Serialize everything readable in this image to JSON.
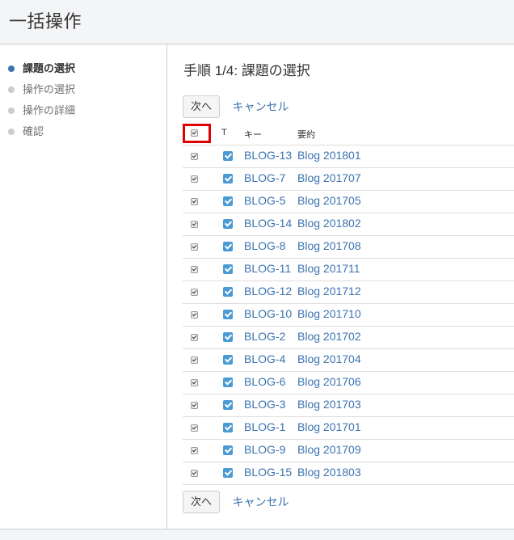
{
  "page_title": "一括操作",
  "steps": [
    {
      "label": "課題の選択",
      "active": true
    },
    {
      "label": "操作の選択",
      "active": false
    },
    {
      "label": "操作の詳細",
      "active": false
    },
    {
      "label": "確認",
      "active": false
    }
  ],
  "main": {
    "heading": "手順 1/4: 課題の選択",
    "next_label": "次へ",
    "cancel_label": "キャンセル"
  },
  "table": {
    "headers": {
      "type": "T",
      "key": "キー",
      "summary": "要約"
    },
    "rows": [
      {
        "key": "BLOG-13",
        "summary": "Blog 201801",
        "selected": true
      },
      {
        "key": "BLOG-7",
        "summary": "Blog 201707",
        "selected": true
      },
      {
        "key": "BLOG-5",
        "summary": "Blog 201705",
        "selected": true
      },
      {
        "key": "BLOG-14",
        "summary": "Blog 201802",
        "selected": true
      },
      {
        "key": "BLOG-8",
        "summary": "Blog 201708",
        "selected": true
      },
      {
        "key": "BLOG-11",
        "summary": "Blog 201711",
        "selected": true
      },
      {
        "key": "BLOG-12",
        "summary": "Blog 201712",
        "selected": true
      },
      {
        "key": "BLOG-10",
        "summary": "Blog 201710",
        "selected": true
      },
      {
        "key": "BLOG-2",
        "summary": "Blog 201702",
        "selected": true
      },
      {
        "key": "BLOG-4",
        "summary": "Blog 201704",
        "selected": true
      },
      {
        "key": "BLOG-6",
        "summary": "Blog 201706",
        "selected": true
      },
      {
        "key": "BLOG-3",
        "summary": "Blog 201703",
        "selected": true
      },
      {
        "key": "BLOG-1",
        "summary": "Blog 201701",
        "selected": true
      },
      {
        "key": "BLOG-9",
        "summary": "Blog 201709",
        "selected": true
      },
      {
        "key": "BLOG-15",
        "summary": "Blog 201803",
        "selected": true
      }
    ]
  },
  "colors": {
    "link": "#3b73af",
    "active_dot": "#3b73af",
    "highlight": "#e00000",
    "type_icon": "#4a9ad4"
  }
}
